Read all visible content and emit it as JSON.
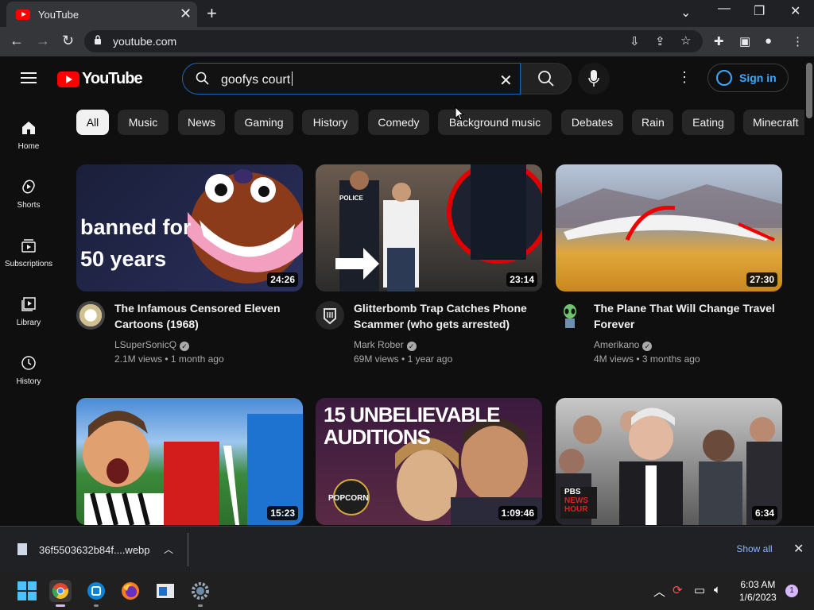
{
  "browser": {
    "tab_title": "YouTube",
    "url": "youtube.com"
  },
  "yt": {
    "logo": "YouTube",
    "search": {
      "query": "goofys court"
    },
    "signin": "Sign in",
    "sidebar": [
      {
        "label": "Home",
        "icon": "home-icon"
      },
      {
        "label": "Shorts",
        "icon": "shorts-icon"
      },
      {
        "label": "Subscriptions",
        "icon": "subscriptions-icon"
      },
      {
        "label": "Library",
        "icon": "library-icon"
      },
      {
        "label": "History",
        "icon": "history-icon"
      }
    ],
    "chips": [
      "All",
      "Music",
      "News",
      "Gaming",
      "History",
      "Comedy",
      "Background music",
      "Debates",
      "Rain",
      "Eating",
      "Minecraft"
    ],
    "videos": [
      {
        "title_1": "The Infamous Censored Eleven",
        "title_2": "Cartoons (1968)",
        "channel": "LSuperSonicQ",
        "views": "2.1M views",
        "age": "1 month ago",
        "duration": "24:26",
        "thumb_text_1": "banned for",
        "thumb_text_2": "50 years"
      },
      {
        "title_1": "Glitterbomb Trap Catches Phone",
        "title_2": "Scammer (who gets arrested)",
        "channel": "Mark Rober",
        "views": "69M views",
        "age": "1 year ago",
        "duration": "23:14",
        "thumb_text_1": "POLICE"
      },
      {
        "title_1": "The Plane That Will Change Travel",
        "title_2": "Forever",
        "channel": "Amerikano",
        "views": "4M views",
        "age": "3 months ago",
        "duration": "27:30"
      },
      {
        "duration": "15:23"
      },
      {
        "duration": "1:09:46",
        "thumb_text_1": "15 UNBELIEVABLE",
        "thumb_text_2": "AUDITIONS",
        "thumb_text_3": "POPCORN"
      },
      {
        "duration": "6:34",
        "thumb_text_1": "PBS",
        "thumb_text_2": "NEWS",
        "thumb_text_3": "HOUR"
      }
    ]
  },
  "download": {
    "filename": "36f5503632b84f....webp",
    "show_all": "Show all"
  },
  "taskbar": {
    "time": "6:03 AM",
    "date": "1/6/2023",
    "notifications": "1"
  }
}
